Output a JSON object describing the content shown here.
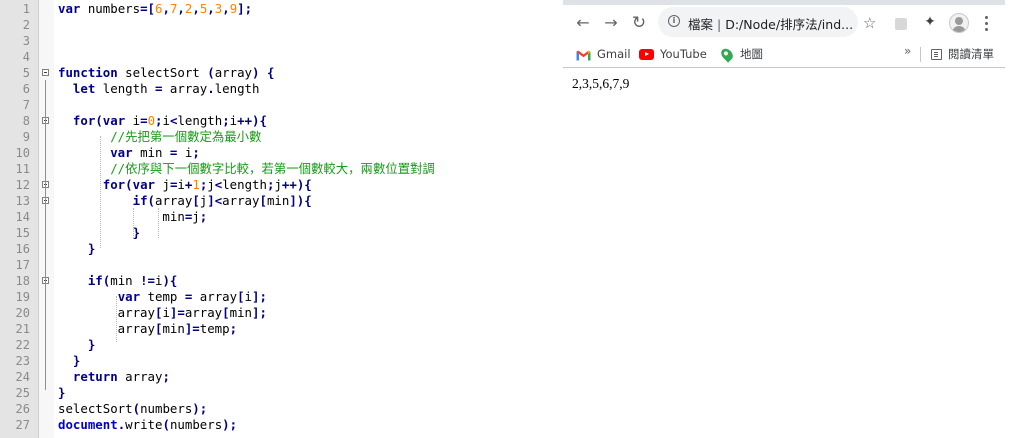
{
  "editor": {
    "lines": [
      {
        "n": "1",
        "html": "<span class='kw'>var</span> numbers<span class='op'>=[</span><span class='num'>6</span><span class='op'>,</span><span class='num'>7</span><span class='op'>,</span><span class='num'>2</span><span class='op'>,</span><span class='num'>5</span><span class='op'>,</span><span class='num'>3</span><span class='op'>,</span><span class='num'>9</span><span class='op'>];</span>"
      },
      {
        "n": "2",
        "html": ""
      },
      {
        "n": "3",
        "html": ""
      },
      {
        "n": "4",
        "html": ""
      },
      {
        "n": "5",
        "html": "<span class='kw'>function</span> selectSort <span class='op'>(</span>array<span class='op'>)</span> <span class='op'>{</span>"
      },
      {
        "n": "6",
        "html": "  <span class='kw'>let</span> length <span class='op'>=</span> array<span class='op'>.</span>length"
      },
      {
        "n": "7",
        "html": ""
      },
      {
        "n": "8",
        "html": "  <span class='kw'>for</span><span class='op'>(</span><span class='kw'>var</span> i<span class='op'>=</span><span class='num'>0</span><span class='op'>;</span>i<span class='op'>&lt;</span>length<span class='op'>;</span>i<span class='op'>++){</span>"
      },
      {
        "n": "9",
        "html": "       <span class='cm'>//先把第一個數定為最小數</span>"
      },
      {
        "n": "10",
        "html": "       <span class='kw'>var</span> min <span class='op'>=</span> i<span class='op'>;</span>"
      },
      {
        "n": "11",
        "html": "       <span class='cm'>//依序與下一個數字比較，若第一個數較大，兩數位置對調</span>"
      },
      {
        "n": "12",
        "html": "      <span class='kw'>for</span><span class='op'>(</span><span class='kw'>var</span> j<span class='op'>=</span>i<span class='op'>+</span><span class='num'>1</span><span class='op'>;</span>j<span class='op'>&lt;</span>length<span class='op'>;</span>j<span class='op'>++){</span>"
      },
      {
        "n": "13",
        "html": "          <span class='kw'>if</span><span class='op'>(</span>array<span class='op'>[</span>j<span class='op'>]&lt;</span>array<span class='op'>[</span>min<span class='op'>]){</span>"
      },
      {
        "n": "14",
        "html": "              min<span class='op'>=</span>j<span class='op'>;</span>"
      },
      {
        "n": "15",
        "html": "          <span class='op'>}</span>"
      },
      {
        "n": "16",
        "html": "    <span class='op'>}</span>"
      },
      {
        "n": "17",
        "html": ""
      },
      {
        "n": "18",
        "html": "    <span class='kw'>if</span><span class='op'>(</span>min <span class='op'>!=</span>i<span class='op'>){</span>"
      },
      {
        "n": "19",
        "html": "        <span class='kw'>var</span> temp <span class='op'>=</span> array<span class='op'>[</span>i<span class='op'>];</span>"
      },
      {
        "n": "20",
        "html": "        array<span class='op'>[</span>i<span class='op'>]=</span>array<span class='op'>[</span>min<span class='op'>];</span>"
      },
      {
        "n": "21",
        "html": "        array<span class='op'>[</span>min<span class='op'>]=</span>temp<span class='op'>;</span>"
      },
      {
        "n": "22",
        "html": "    <span class='op'>}</span>"
      },
      {
        "n": "23",
        "html": "  <span class='op'>}</span>"
      },
      {
        "n": "24",
        "html": "  <span class='kw'>return</span> array<span class='op'>;</span>"
      },
      {
        "n": "25",
        "html": "<span class='op'>}</span>"
      },
      {
        "n": "26",
        "html": "selectSort<span class='op'>(</span>numbers<span class='op'>);</span>"
      },
      {
        "n": "27",
        "html": "<span class='kw2'>document</span><span class='op'>.</span>write<span class='op'>(</span>numbers<span class='op'>);</span>"
      }
    ],
    "fold_markers": [
      "5",
      "8",
      "12",
      "13",
      "18"
    ]
  },
  "browser": {
    "url_prefix": "檔案",
    "url_separator": "|",
    "url": "D:/Node/排序法/ind...",
    "bookmarks": [
      {
        "label": "Gmail",
        "icon": "gmail-icon"
      },
      {
        "label": "YouTube",
        "icon": "youtube-icon"
      },
      {
        "label": "地圖",
        "icon": "maps-icon"
      }
    ],
    "more_label": "»",
    "reading_list_label": "閱讀清單",
    "page_output": "2,3,5,6,7,9"
  }
}
